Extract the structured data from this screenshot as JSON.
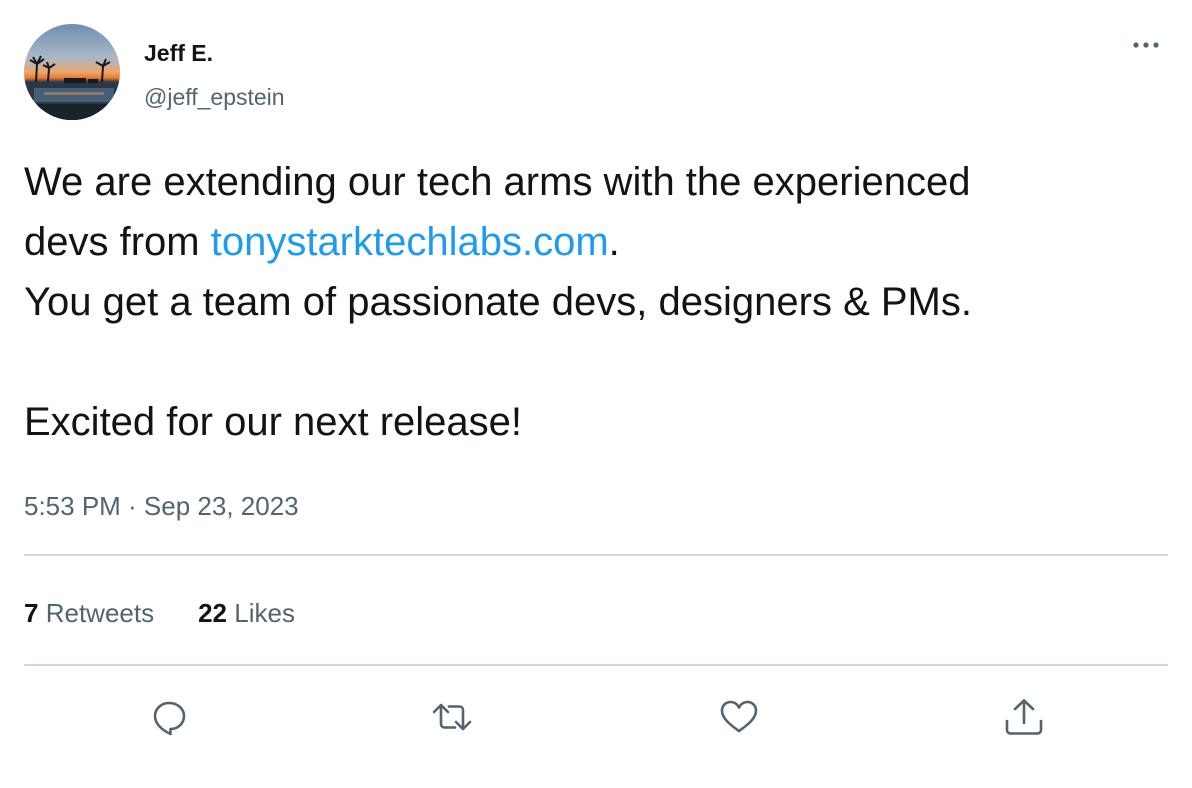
{
  "author": {
    "display_name": "Jeff E.",
    "handle": "@jeff_epstein"
  },
  "tweet": {
    "line1": "We are extending our tech arms with the experienced",
    "line2_prefix": "devs from ",
    "link_text": "tonystarktechlabs.com",
    "line2_suffix": ".",
    "line3": "You get a team of passionate devs, designers & PMs.",
    "line4": "Excited for our next release!",
    "timestamp": "5:53 PM · Sep 23, 2023"
  },
  "stats": {
    "retweets_count": "7",
    "retweets_label": "Retweets",
    "likes_count": "22",
    "likes_label": "Likes"
  },
  "icons": {
    "more": "more-icon",
    "reply": "reply-icon",
    "retweet": "retweet-icon",
    "like": "heart-icon",
    "share": "share-icon"
  },
  "colors": {
    "link": "#1d9bf0",
    "secondary_text": "#536471",
    "primary_text": "#0f1419",
    "divider": "#cfd9de"
  }
}
